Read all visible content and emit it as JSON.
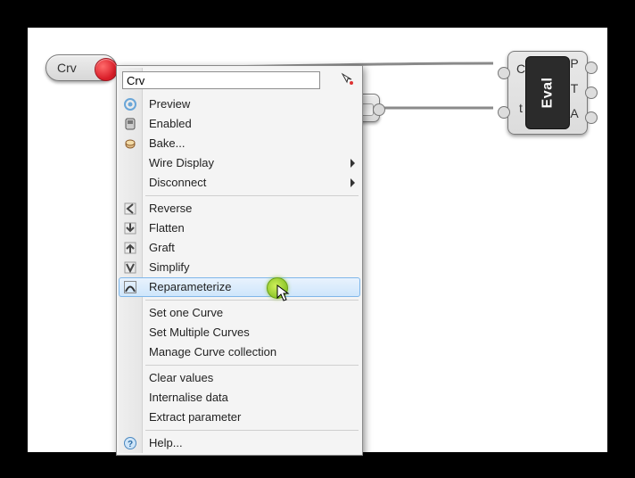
{
  "nodes": {
    "crv_label": "Crv",
    "eval_label": "Eval",
    "eval_inputs": {
      "c": "C",
      "t": "t"
    },
    "eval_outputs": {
      "p": "P",
      "t": "T",
      "a": "A"
    }
  },
  "context_menu": {
    "search_value": "Crv",
    "items": {
      "preview": {
        "label": "Preview"
      },
      "enabled": {
        "label": "Enabled"
      },
      "bake": {
        "label": "Bake..."
      },
      "wire": {
        "label": "Wire Display"
      },
      "disconnect": {
        "label": "Disconnect"
      },
      "reverse": {
        "label": "Reverse"
      },
      "flatten": {
        "label": "Flatten"
      },
      "graft": {
        "label": "Graft"
      },
      "simplify": {
        "label": "Simplify"
      },
      "reparam": {
        "label": "Reparameterize"
      },
      "set_one": {
        "label": "Set one Curve"
      },
      "set_multi": {
        "label": "Set Multiple Curves"
      },
      "manage": {
        "label": "Manage Curve collection"
      },
      "clear": {
        "label": "Clear values"
      },
      "internalise": {
        "label": "Internalise data"
      },
      "extract": {
        "label": "Extract parameter"
      },
      "help": {
        "label": "Help..."
      }
    }
  }
}
